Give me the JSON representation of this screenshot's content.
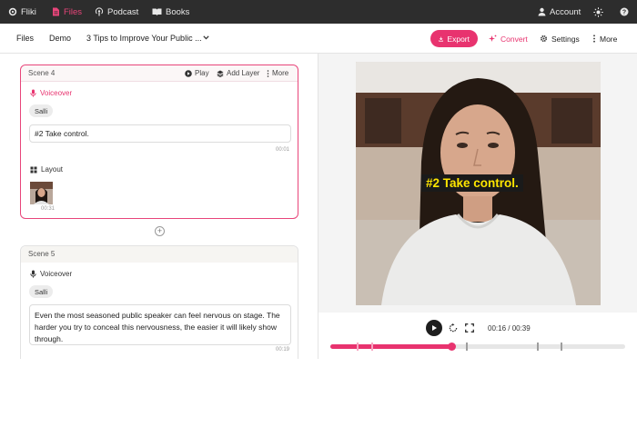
{
  "topnav": {
    "items": [
      {
        "label": "Fliki",
        "icon": "gear-icon"
      },
      {
        "label": "Files",
        "icon": "file-icon",
        "active": true
      },
      {
        "label": "Podcast",
        "icon": "podcast-icon"
      },
      {
        "label": "Books",
        "icon": "book-icon"
      }
    ],
    "account_label": "Account",
    "theme_icon": "sun-icon"
  },
  "breadcrumb": {
    "items": [
      "Files",
      "Demo",
      "3 Tips to Improve Your Public ..."
    ],
    "dropdown_icon": "chevron-down-icon"
  },
  "toolbar": {
    "export_label": "Export",
    "convert_label": "Convert",
    "settings_label": "Settings",
    "more_label": "More"
  },
  "scenes": [
    {
      "title": "Scene 4",
      "play_label": "Play",
      "add_layer_label": "Add Layer",
      "more_label": "More",
      "voiceover_label": "Voiceover",
      "voice": "Salli",
      "text": "#2 Take control.",
      "duration": "00:01",
      "layout_label": "Layout",
      "layout_duration": "00:31"
    },
    {
      "title": "Scene 5",
      "voiceover_label": "Voiceover",
      "voice": "Salli",
      "text": "Even the most seasoned public speaker can feel nervous on stage. The harder you try to conceal this nervousness, the easier it will likely show through.",
      "duration": "00:19"
    }
  ],
  "preview": {
    "caption": "#2 Take control.",
    "time": "00:16 / 00:39",
    "progress": 0.41,
    "scene_marks": [
      0.09,
      0.14,
      0.46,
      0.7,
      0.78
    ]
  },
  "colors": {
    "accent": "#e8336f",
    "nav_bg": "#2d2d2d",
    "caption_bg": "#1a1a1a",
    "caption_text": "#ffe600"
  }
}
